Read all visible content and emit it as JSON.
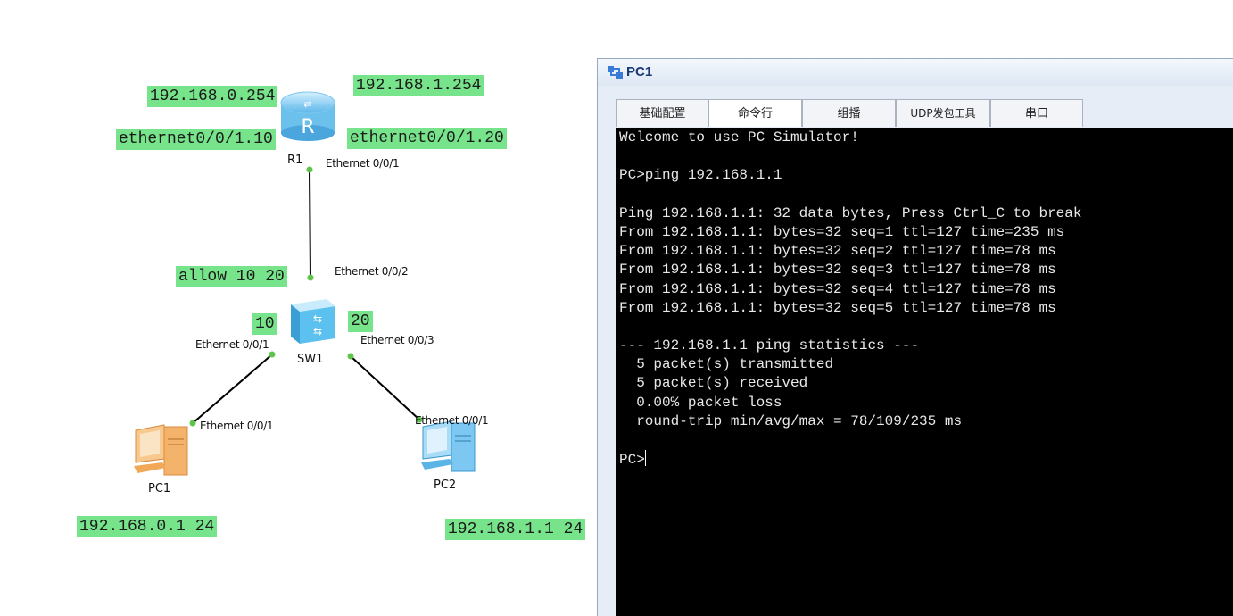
{
  "topology": {
    "devices": {
      "router": {
        "name": "R1",
        "icon": "router-icon"
      },
      "switch": {
        "name": "SW1",
        "icon": "switch-icon"
      },
      "pc1": {
        "name": "PC1",
        "icon": "pc-icon"
      },
      "pc2": {
        "name": "PC2",
        "icon": "pc-icon"
      }
    },
    "ports": {
      "r1_e001": "Ethernet 0/0/1",
      "sw1_e002": "Ethernet 0/0/2",
      "sw1_e001": "Ethernet 0/0/1",
      "sw1_e003": "Ethernet 0/0/3",
      "pc1_e001": "Ethernet 0/0/1",
      "pc2_e001": "Ethernet 0/0/1"
    },
    "annotations": {
      "gw_vlan10": "192.168.0.254",
      "gw_vlan20": "192.168.1.254",
      "subif_10": "ethernet0/0/1.10",
      "subif_20": "ethernet0/0/1.20",
      "trunk_allow": "allow 10 20",
      "vlan_left": "10",
      "vlan_right": "20",
      "pc1_ip": "192.168.0.1 24",
      "pc2_ip": "192.168.1.1 24"
    },
    "colors": {
      "label_bg": "#77e38a",
      "link": "#000000",
      "port_dot": "#5ec44a"
    }
  },
  "window": {
    "title": "PC1",
    "tabs": [
      "基础配置",
      "命令行",
      "组播",
      "UDP发包工具",
      "串口"
    ],
    "active_tab": "命令行",
    "console_lines": [
      "Welcome to use PC Simulator!",
      "",
      "PC>ping 192.168.1.1",
      "",
      "Ping 192.168.1.1: 32 data bytes, Press Ctrl_C to break",
      "From 192.168.1.1: bytes=32 seq=1 ttl=127 time=235 ms",
      "From 192.168.1.1: bytes=32 seq=2 ttl=127 time=78 ms",
      "From 192.168.1.1: bytes=32 seq=3 ttl=127 time=78 ms",
      "From 192.168.1.1: bytes=32 seq=4 ttl=127 time=78 ms",
      "From 192.168.1.1: bytes=32 seq=5 ttl=127 time=78 ms",
      "",
      "--- 192.168.1.1 ping statistics ---",
      "  5 packet(s) transmitted",
      "  5 packet(s) received",
      "  0.00% packet loss",
      "  round-trip min/avg/max = 78/109/235 ms",
      ""
    ],
    "prompt": "PC>"
  }
}
